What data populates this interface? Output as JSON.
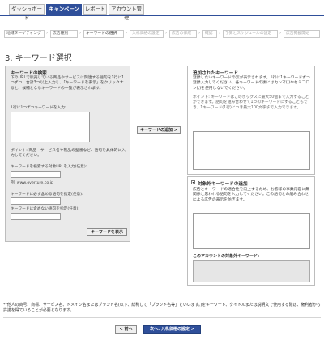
{
  "tabs": [
    {
      "label": "ダッシュボード"
    },
    {
      "label": "キャンペーン"
    },
    {
      "label": "レポート"
    },
    {
      "label": "アカウント管理"
    }
  ],
  "breadcrumb": [
    {
      "label": "地域ターゲティング"
    },
    {
      "label": "広告種別"
    },
    {
      "label": "キーワードの選択"
    },
    {
      "label": "入札価格の設定"
    },
    {
      "label": "広告の作成"
    },
    {
      "label": "確認"
    },
    {
      "label": "予算とスケジュールの設定"
    },
    {
      "label": "広告掲載開始"
    }
  ],
  "page_title": "3. キーワード選択",
  "keyword_search": {
    "title": "キーワードの検索",
    "description": "下のURLで販売している商品やサービスに関連する語句を1行に1つずつ、合計3つ以上入力し、「キーワードを表示」をクリックすると、候補となるキーワードの一覧が表示されます。",
    "input_label": "1行に1つずつキーワードを入力:",
    "point": "ポイント: 商品・サービス名や製品の型番など、語句を具体的に入力してください。",
    "url_label": "キーワードを検索する対象URLを入力(任意):",
    "url_example": "例: www.overture.co.jp",
    "include_label": "キーワードに必ず含める語句を指定(任意):",
    "exclude_label": "キーワードに含めない語句を指定(任意):",
    "show_button": "キーワードを表示"
  },
  "add_button": "キーワードの追加 >",
  "added_keywords": {
    "title": "追加されたキーワード",
    "description": "登録したいキーワードの案が表示されます。1行に1キーワードずつ登録入力してください。各キーワードの後にはカンマ(,)やセミコロン(;)を使用しないでください。",
    "point": "ポイント: キーワードはこのボックスに最大50個まで入力することができます。語句を組み合わせて1つのキーワードにすることもでき、1キーワード(1行)につき最大100文字まで入力できます。"
  },
  "excluded_keywords": {
    "title": "対象外キーワードの追加",
    "description": "広告とキーワードの適合性を向上するため、お客様の事業内容に無関係と思われる語句を入力してください。この語句との組み合わせによる広告の表示を防ぎます。",
    "account_label": "このアカウントの対象外キーワード:"
  },
  "footnote": "**他人の商号、商標、サービス名、ドメイン名またはブランド名(以下、総称して「ブランド名等」といいます。)をキーワード、タイトルまたは説明文で使用する際は、権利者から許諾を得ていることが必要となります。",
  "nav": {
    "back": "< 前へ",
    "next": "次へ: 入札価格の設定 >"
  },
  "colors": {
    "accent": "#2f4f9a",
    "panel_bg": "#eaeaea"
  }
}
